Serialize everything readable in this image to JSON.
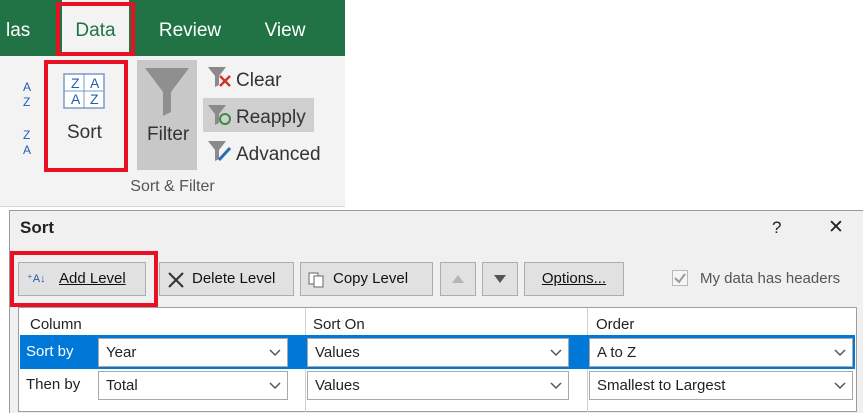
{
  "ribbon": {
    "tabs": [
      {
        "label": "las"
      },
      {
        "label": "Data"
      },
      {
        "label": "Review"
      },
      {
        "label": "View"
      }
    ],
    "sort_label": "Sort",
    "filter_label": "Filter",
    "clear_label": "Clear",
    "reapply_label": "Reapply",
    "advanced_label": "Advanced",
    "group_label": "Sort & Filter",
    "sort_icon_letters": {
      "z": "Z",
      "a": "A"
    }
  },
  "dialog": {
    "title": "Sort",
    "help": "?",
    "close": "✕",
    "toolbar": {
      "add_level": "Add Level",
      "delete_level": "Delete Level",
      "copy_level": "Copy Level",
      "options": "Options...",
      "headers_checkbox": "My data has headers"
    },
    "columns": [
      "Column",
      "Sort On",
      "Order"
    ],
    "rows": [
      {
        "label": "Sort by",
        "column": "Year",
        "sort_on": "Values",
        "order": "A to Z"
      },
      {
        "label": "Then by",
        "column": "Total",
        "sort_on": "Values",
        "order": "Smallest to Largest"
      }
    ]
  },
  "colors": {
    "excel_green": "#217346",
    "highlight": "#e81123",
    "selection": "#0078d7"
  }
}
